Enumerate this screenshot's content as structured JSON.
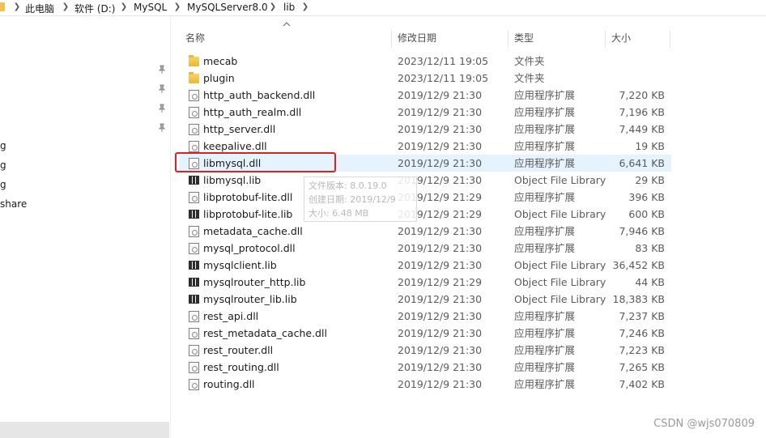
{
  "breadcrumb": {
    "items": [
      "此电脑",
      "软件 (D:)",
      "MySQL",
      "MySQLServer8.0",
      "lib"
    ]
  },
  "nav": {
    "partial_items": [
      "g",
      "g",
      "g",
      "share"
    ]
  },
  "columns": {
    "name": "名称",
    "date": "修改日期",
    "type": "类型",
    "size": "大小"
  },
  "files": [
    {
      "name": "mecab",
      "date": "2023/12/11 19:05",
      "type": "文件夹",
      "size": "",
      "icon": "folder-icon"
    },
    {
      "name": "plugin",
      "date": "2023/12/11 19:05",
      "type": "文件夹",
      "size": "",
      "icon": "folder-icon"
    },
    {
      "name": "http_auth_backend.dll",
      "date": "2019/12/9 21:30",
      "type": "应用程序扩展",
      "size": "7,220 KB",
      "icon": "dll-file-icon"
    },
    {
      "name": "http_auth_realm.dll",
      "date": "2019/12/9 21:30",
      "type": "应用程序扩展",
      "size": "7,196 KB",
      "icon": "dll-file-icon"
    },
    {
      "name": "http_server.dll",
      "date": "2019/12/9 21:30",
      "type": "应用程序扩展",
      "size": "7,449 KB",
      "icon": "dll-file-icon"
    },
    {
      "name": "keepalive.dll",
      "date": "2019/12/9 21:30",
      "type": "应用程序扩展",
      "size": "19 KB",
      "icon": "dll-file-icon"
    },
    {
      "name": "libmysql.dll",
      "date": "2019/12/9 21:30",
      "type": "应用程序扩展",
      "size": "6,641 KB",
      "icon": "dll-file-icon",
      "selected": true
    },
    {
      "name": "libmysql.lib",
      "date": "2019/12/9 21:30",
      "type": "Object File Library",
      "size": "29 KB",
      "icon": "lib-file-icon"
    },
    {
      "name": "libprotobuf-lite.dll",
      "date": "2019/12/9 21:29",
      "type": "应用程序扩展",
      "size": "396 KB",
      "icon": "dll-file-icon"
    },
    {
      "name": "libprotobuf-lite.lib",
      "date": "2019/12/9 21:29",
      "type": "Object File Library",
      "size": "600 KB",
      "icon": "lib-file-icon"
    },
    {
      "name": "metadata_cache.dll",
      "date": "2019/12/9 21:30",
      "type": "应用程序扩展",
      "size": "7,946 KB",
      "icon": "dll-file-icon"
    },
    {
      "name": "mysql_protocol.dll",
      "date": "2019/12/9 21:30",
      "type": "应用程序扩展",
      "size": "83 KB",
      "icon": "dll-file-icon"
    },
    {
      "name": "mysqlclient.lib",
      "date": "2019/12/9 21:30",
      "type": "Object File Library",
      "size": "36,452 KB",
      "icon": "lib-file-icon"
    },
    {
      "name": "mysqlrouter_http.lib",
      "date": "2019/12/9 21:29",
      "type": "Object File Library",
      "size": "44 KB",
      "icon": "lib-file-icon"
    },
    {
      "name": "mysqlrouter_lib.lib",
      "date": "2019/12/9 21:30",
      "type": "Object File Library",
      "size": "18,383 KB",
      "icon": "lib-file-icon"
    },
    {
      "name": "rest_api.dll",
      "date": "2019/12/9 21:30",
      "type": "应用程序扩展",
      "size": "7,237 KB",
      "icon": "dll-file-icon"
    },
    {
      "name": "rest_metadata_cache.dll",
      "date": "2019/12/9 21:30",
      "type": "应用程序扩展",
      "size": "7,246 KB",
      "icon": "dll-file-icon"
    },
    {
      "name": "rest_router.dll",
      "date": "2019/12/9 21:30",
      "type": "应用程序扩展",
      "size": "7,223 KB",
      "icon": "dll-file-icon"
    },
    {
      "name": "rest_routing.dll",
      "date": "2019/12/9 21:30",
      "type": "应用程序扩展",
      "size": "7,265 KB",
      "icon": "dll-file-icon"
    },
    {
      "name": "routing.dll",
      "date": "2019/12/9 21:30",
      "type": "应用程序扩展",
      "size": "7,402 KB",
      "icon": "dll-file-icon"
    }
  ],
  "tooltip": {
    "version": "文件版本: 8.0.19.0",
    "created": "创建日期: 2019/12/9",
    "size": "大小: 6.48 MB"
  },
  "watermark": "CSDN @wjs070809",
  "colors": {
    "selection": "#e5f3ff",
    "highlight_border": "#e02020",
    "folder": "#f0c34f"
  }
}
